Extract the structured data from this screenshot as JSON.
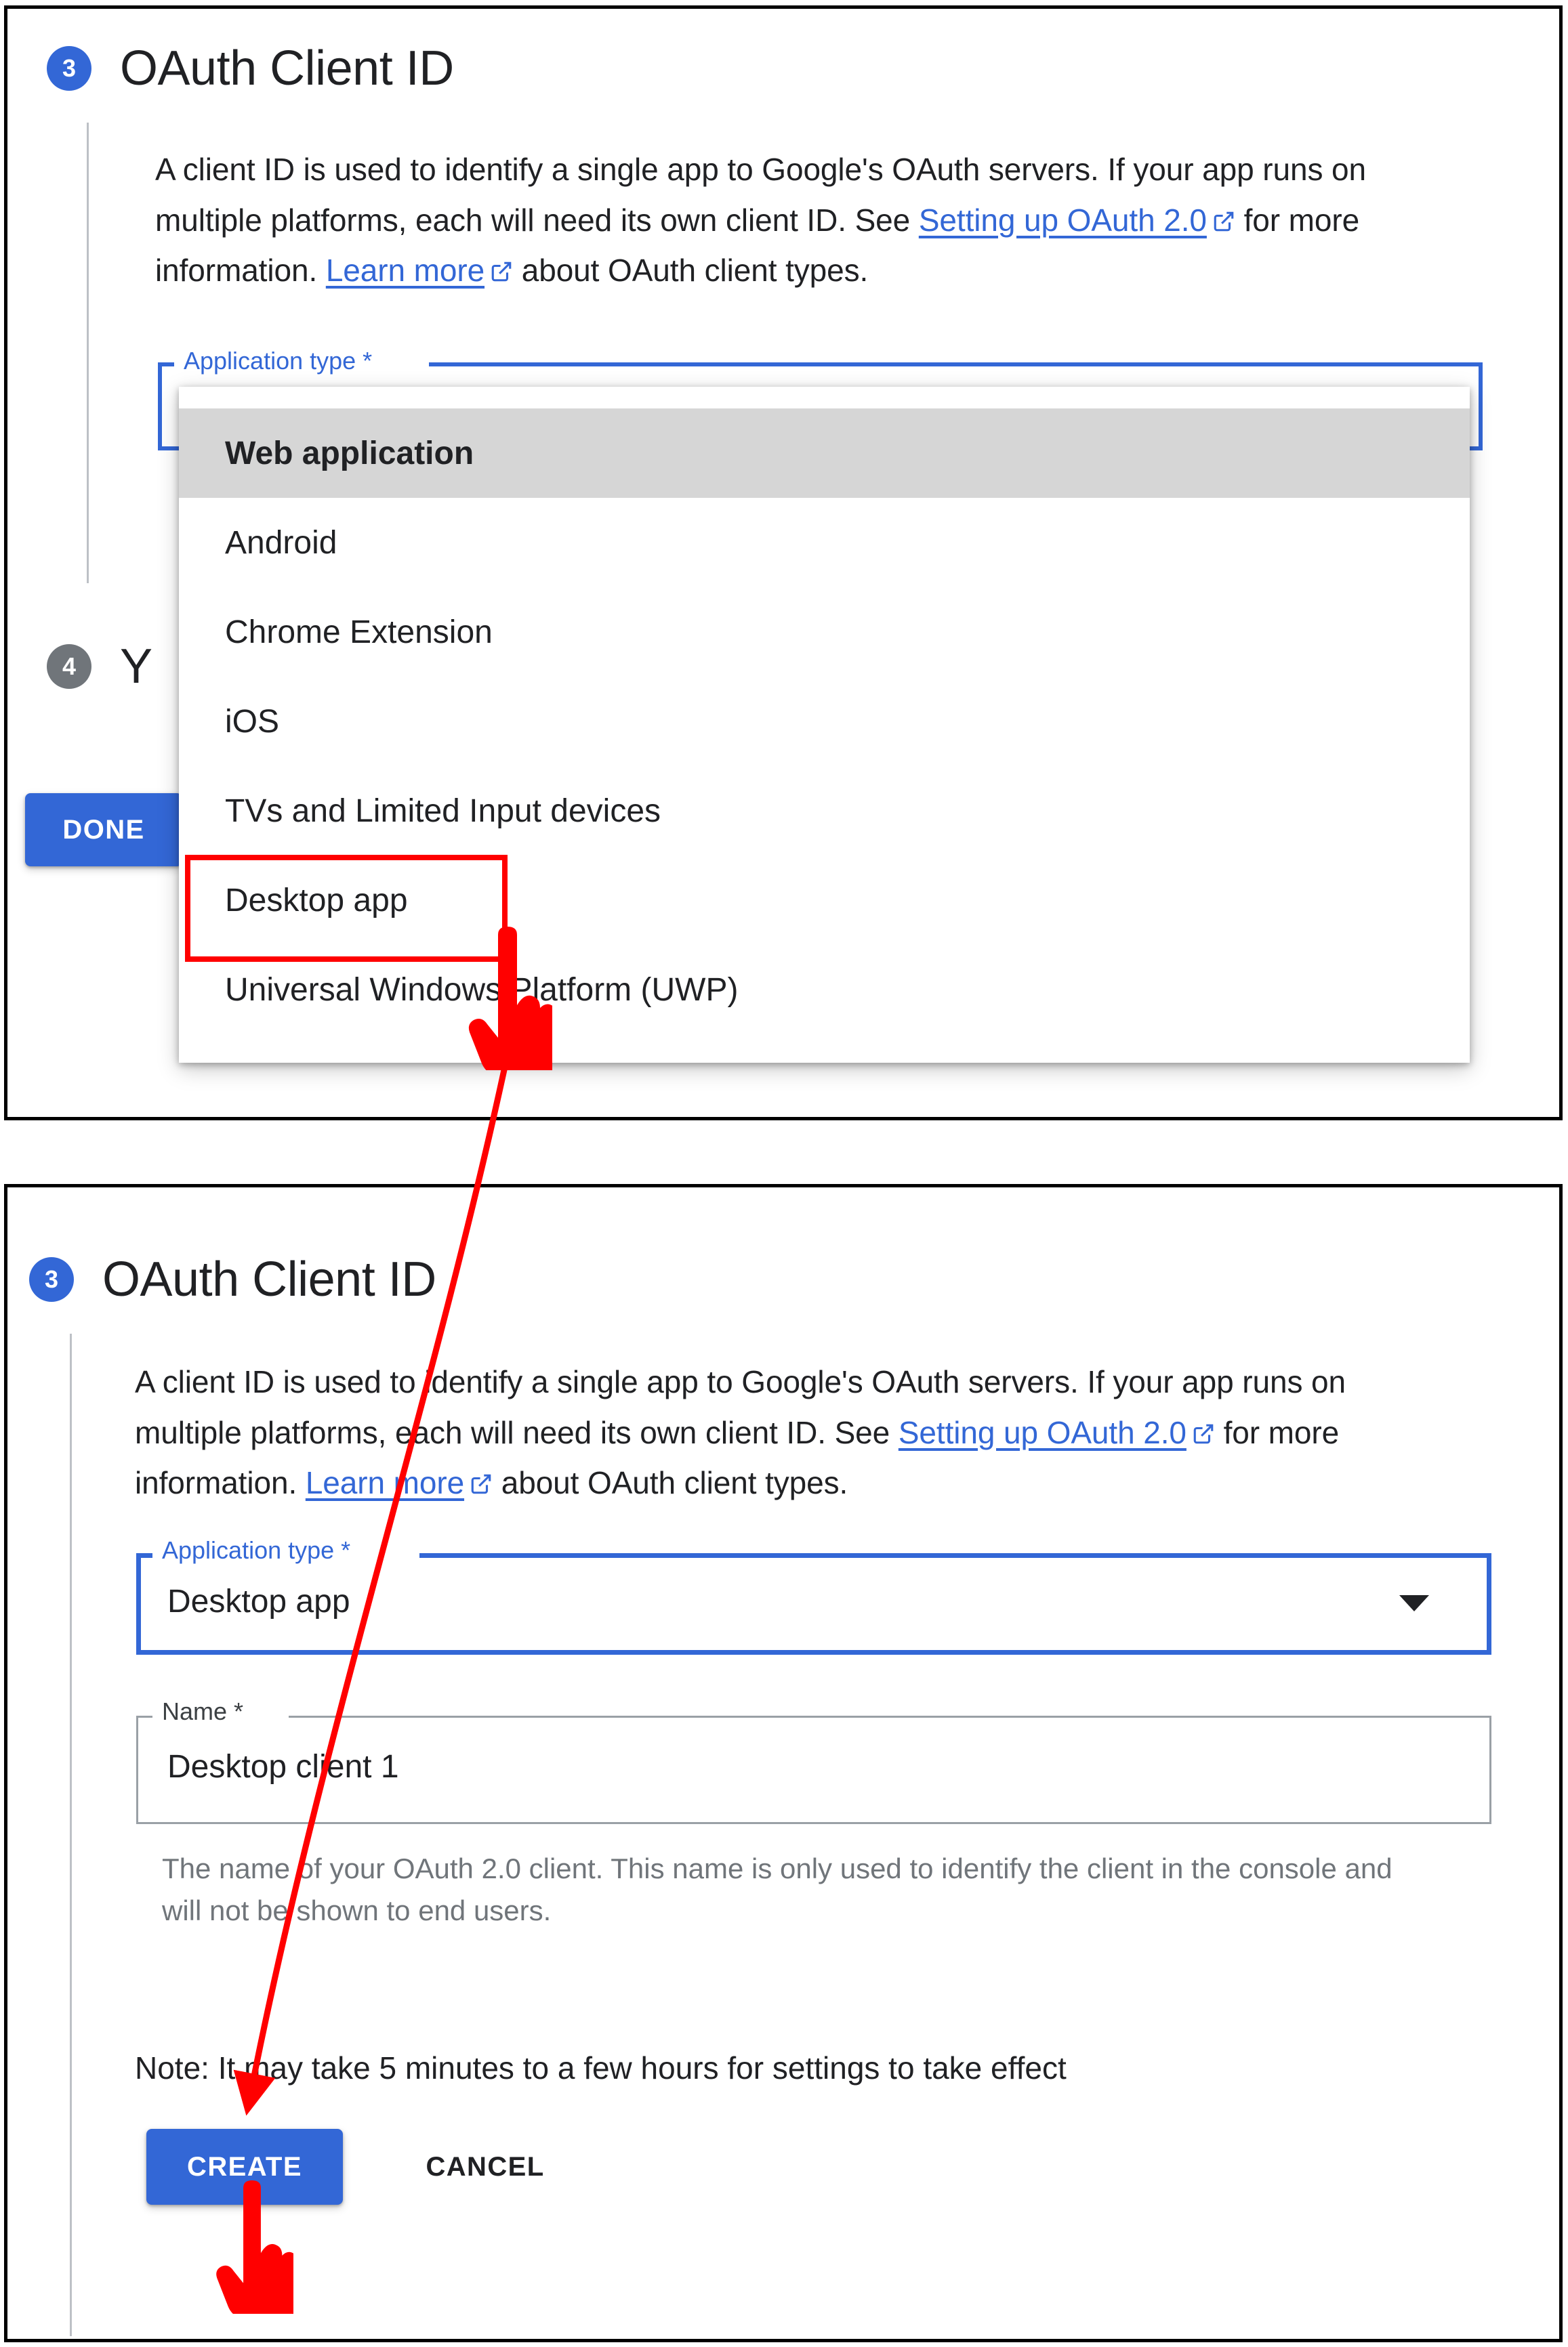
{
  "meta": {
    "accent_blue": "#3367d6",
    "annotation_red": "#ff0000",
    "step_grey": "#70757a",
    "highlight_grey": "#d6d6d6"
  },
  "panel_top": {
    "step": {
      "number": "3",
      "title": "OAuth Client ID"
    },
    "description": {
      "seg1": "A client ID is used to identify a single app to Google's OAuth servers. If your app runs on multiple platforms, each will need its own client ID. See ",
      "link1": "Setting up OAuth 2.0",
      "seg2": " for more information. ",
      "link2": "Learn more",
      "seg3": " about OAuth client types."
    },
    "application_type_field": {
      "label": "Application type *",
      "value": ""
    },
    "dropdown": {
      "options": [
        "Web application",
        "Android",
        "Chrome Extension",
        "iOS",
        "TVs and Limited Input devices",
        "Desktop app",
        "Universal Windows Platform (UWP)"
      ],
      "selected": "Web application",
      "highlighted_option": "Desktop app"
    },
    "next_step": {
      "number": "4",
      "title_visible": "Y"
    },
    "done_button": "DONE"
  },
  "panel_bottom": {
    "step": {
      "number": "3",
      "title": "OAuth Client ID"
    },
    "description": {
      "seg1": "A client ID is used to identify a single app to Google's OAuth servers. If your app runs on multiple platforms, each will need its own client ID. See ",
      "link1": "Setting up OAuth 2.0",
      "seg2": " for more information. ",
      "link2": "Learn more",
      "seg3": " about OAuth client types."
    },
    "application_type_field": {
      "label": "Application type *",
      "value": "Desktop app"
    },
    "name_field": {
      "label": "Name *",
      "value": "Desktop client 1"
    },
    "name_helper": "The name of your OAuth 2.0 client. This name is only used to identify the client in the console and will not be shown to end users.",
    "note": "Note: It may take 5 minutes to a few hours for settings to take effect",
    "create_button": "CREATE",
    "cancel_button": "CANCEL"
  }
}
